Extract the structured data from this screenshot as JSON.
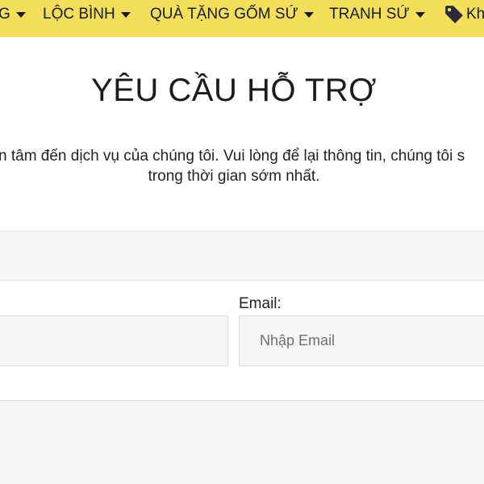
{
  "nav": {
    "items": [
      {
        "label": "G"
      },
      {
        "label": "LỘC BÌNH"
      },
      {
        "label": "QUÀ TẶNG GỐM SỨ"
      },
      {
        "label": "TRANH SỨ"
      },
      {
        "label": "Kh"
      }
    ],
    "background": "#f3df5a"
  },
  "main": {
    "title": "YÊU CẦU HỖ TRỢ",
    "intro_line1": "n tâm đến dịch vụ của chúng tôi. Vui lòng để lại thông tin, chúng tôi s",
    "intro_line2": "trong thời gian sớm nhất."
  },
  "form": {
    "email_label": "Email:",
    "email_placeholder": "Nhập Email",
    "email_value": ""
  },
  "icons": {
    "tag": "tag-icon",
    "caret": "caret-down-icon"
  }
}
